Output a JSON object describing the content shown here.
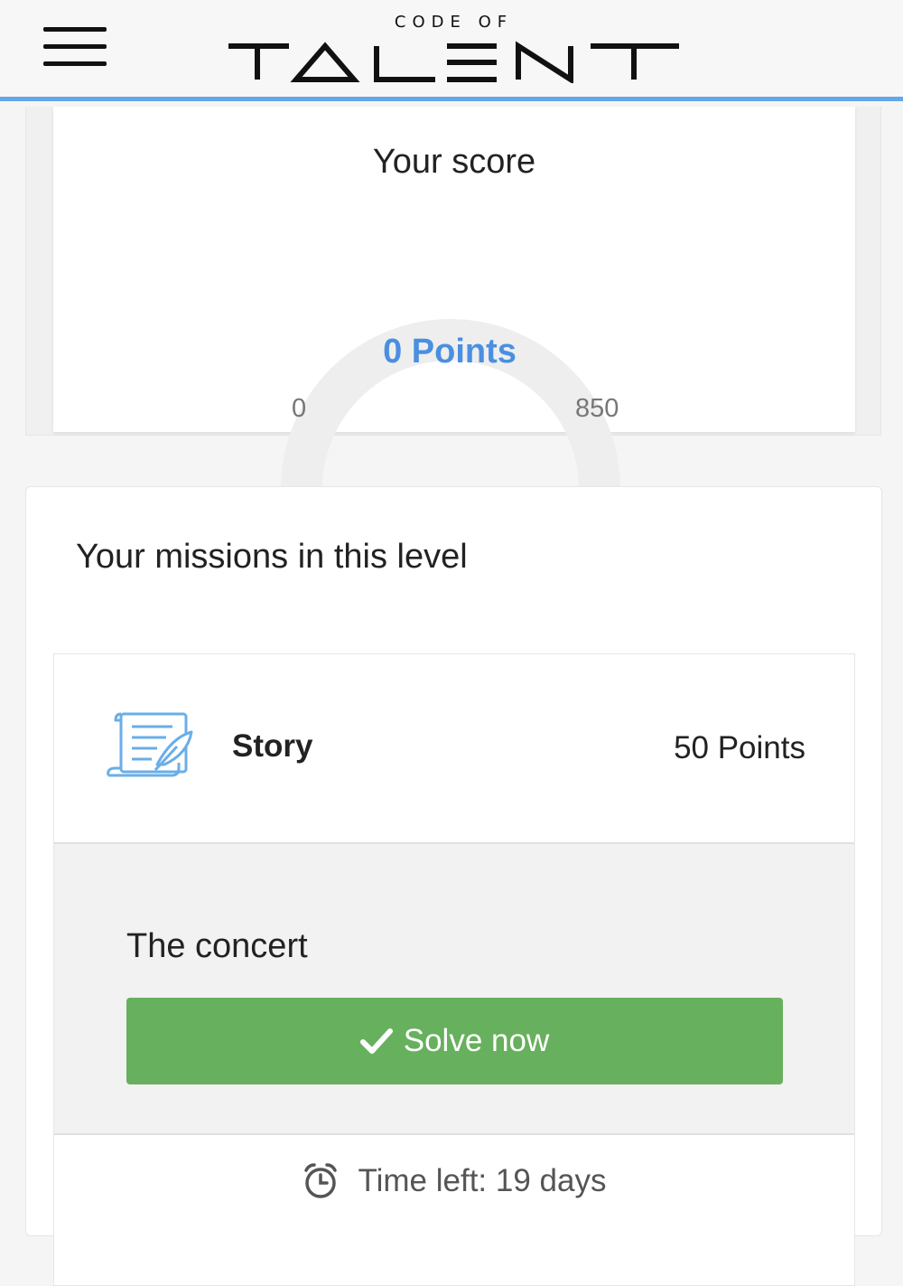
{
  "header": {
    "logo_top": "CODE OF",
    "logo_main": "TALENT"
  },
  "score": {
    "title": "Your score",
    "points_label": "0 Points",
    "current": 0,
    "min": "0",
    "max": "850"
  },
  "missions": {
    "title": "Your missions in this level",
    "items": [
      {
        "type": "Story",
        "points": "50 Points",
        "name": "The concert",
        "button_label": "Solve now",
        "time_left": "Time left: 19 days"
      }
    ]
  },
  "colors": {
    "accent": "#4a8fe0",
    "header_border": "#63a7e6",
    "button_green": "#67b05d",
    "gauge_track": "#eeeeee"
  },
  "icons": [
    "menu-icon",
    "story-scroll-icon",
    "checkmark-icon",
    "alarm-clock-icon"
  ]
}
